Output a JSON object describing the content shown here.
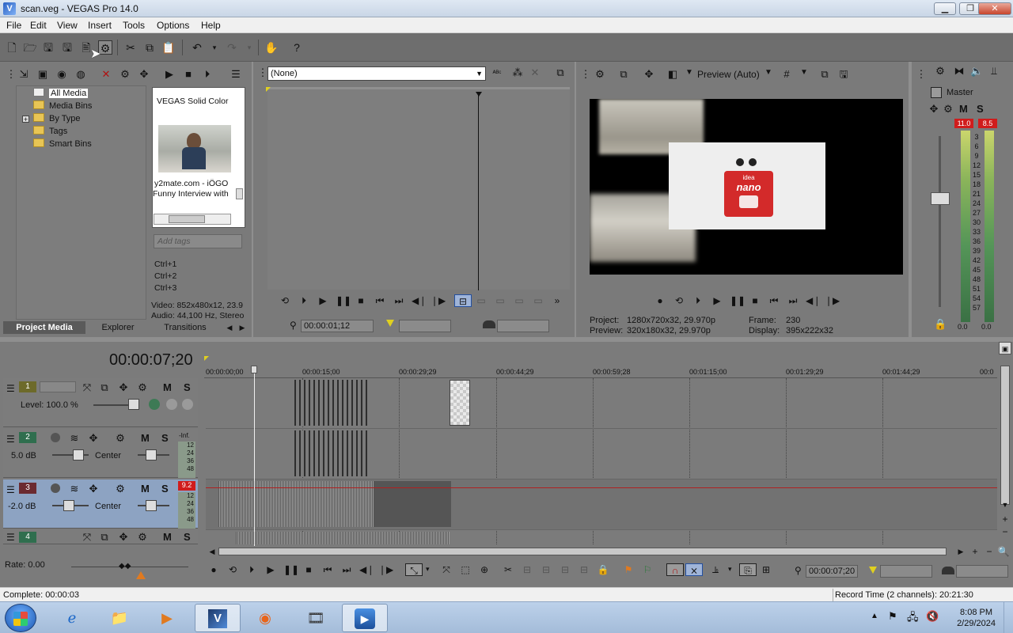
{
  "window": {
    "title": "scan.veg - VEGAS Pro 14.0",
    "minimize": "▁",
    "maximize": "❐",
    "close": "✕"
  },
  "menu": [
    "File",
    "Edit",
    "View",
    "Insert",
    "Tools",
    "Options",
    "Help"
  ],
  "project_media": {
    "tree": [
      "All Media",
      "Media Bins",
      "By Type",
      "Tags",
      "Smart Bins"
    ],
    "expander": "+",
    "thumb1_title": "VEGAS Solid Color",
    "thumb2_line1": "y2mate.com - iÖGO r",
    "thumb2_line2": "Funny Interview with",
    "tags_placeholder": "Add tags",
    "shortcuts": [
      "Ctrl+1",
      "Ctrl+2",
      "Ctrl+3"
    ],
    "info_video": "Video: 852x480x12, 23.9",
    "info_audio": "Audio: 44,100 Hz, Stereo",
    "tabs": [
      "Project Media",
      "Explorer",
      "Transitions"
    ]
  },
  "trimmer": {
    "select_value": "(None)",
    "timecode": "00:00:01;12"
  },
  "preview": {
    "mode": "Preview (Auto)",
    "video_label_top": "idea",
    "video_label_brand": "nano",
    "project_label": "Project:",
    "project_value": "1280x720x32, 29.970p",
    "preview_label": "Preview:",
    "preview_value": "320x180x32, 29.970p",
    "frame_label": "Frame:",
    "frame_value": "230",
    "display_label": "Display:",
    "display_value": "395x222x32"
  },
  "master": {
    "label": "Master",
    "m": "M",
    "s": "S",
    "peak_left": "11.0",
    "peak_right": "8.5",
    "scale": [
      "3",
      "6",
      "9",
      "12",
      "15",
      "18",
      "21",
      "24",
      "27",
      "30",
      "33",
      "36",
      "39",
      "42",
      "45",
      "48",
      "51",
      "54",
      "57"
    ],
    "bottom_left": "0.0",
    "bottom_right": "0.0"
  },
  "timeline": {
    "current_time": "00:00:07;20",
    "ruler": [
      "00:00:00;00",
      "00:00:15;00",
      "00:00:29;29",
      "00:00:44;29",
      "00:00:59;28",
      "00:01:15;00",
      "00:01:29;29",
      "00:01:44;29",
      "00:0"
    ],
    "tracks": [
      {
        "num": "1",
        "m": "M",
        "s": "S",
        "level": "Level: 100.0 %"
      },
      {
        "num": "2",
        "m": "M",
        "s": "S",
        "vol": "5.0 dB",
        "pan": "Center",
        "peak": "-Inf.",
        "scale": [
          "12",
          "24",
          "36",
          "48"
        ]
      },
      {
        "num": "3",
        "m": "M",
        "s": "S",
        "vol": "-2.0 dB",
        "pan": "Center",
        "peak": "9.2",
        "scale": [
          "12",
          "24",
          "36",
          "48"
        ]
      },
      {
        "num": "4",
        "m": "M",
        "s": "S"
      }
    ],
    "rate": "Rate: 0.00",
    "bottom_timecode": "00:00:07;20"
  },
  "status": {
    "left": "Complete: 00:00:03",
    "right": "Record Time (2 channels): 20:21:30"
  },
  "taskbar": {
    "time": "8:08 PM",
    "date": "2/29/2024"
  },
  "colors": {
    "accent_red": "#d01c1c",
    "selection_blue": "#8da3c2",
    "panel_gray": "#7a7a7a"
  }
}
